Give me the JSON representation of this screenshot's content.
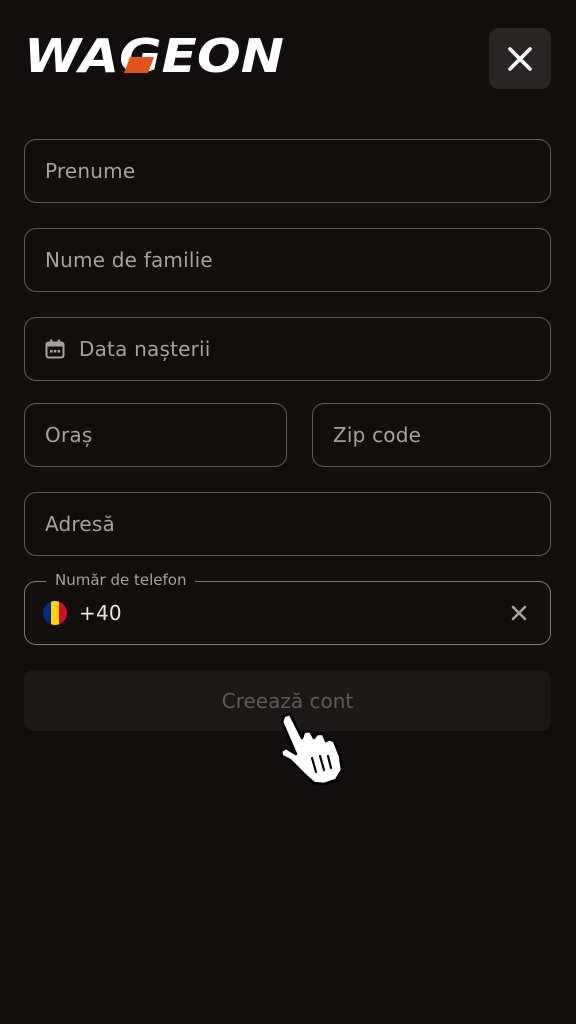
{
  "brand": {
    "logo_text": "WAGEON",
    "logo_color": "#ffffff",
    "logo_accent_color": "#e0531b"
  },
  "header": {
    "close_icon": "close-icon"
  },
  "form": {
    "first_name_placeholder": "Prenume",
    "last_name_placeholder": "Nume de familie",
    "birth_date_placeholder": "Data nașterii",
    "birth_date_icon": "calendar-icon",
    "city_placeholder": "Oraș",
    "zip_placeholder": "Zip code",
    "address_placeholder": "Adresă",
    "phone": {
      "label": "Număr de telefon",
      "country_flag": "romania-flag-icon",
      "flag_colors": [
        "#002b7f",
        "#fcd116",
        "#ce1126"
      ],
      "prefix": "+40",
      "clear_icon": "clear-icon"
    },
    "submit_label": "Creează cont"
  },
  "colors": {
    "background": "#130e0e",
    "border": "#5f5a5a",
    "placeholder": "#a6a1a1",
    "button_bg_disabled": "#1d1818",
    "button_text_disabled": "#5e5959"
  }
}
